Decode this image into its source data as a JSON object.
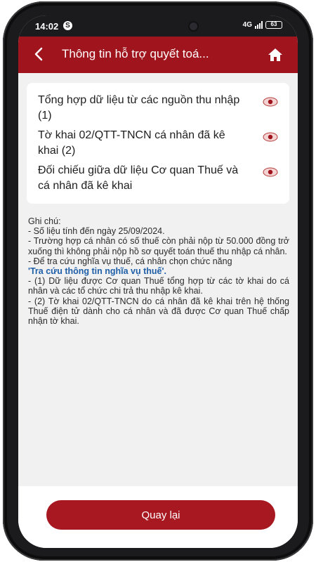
{
  "status_bar": {
    "time": "14:02",
    "app_icon": "S",
    "network": "4G",
    "battery": "63"
  },
  "header": {
    "title": "Thông tin hỗ trợ quyết toá...",
    "back_icon": "chevron-left-icon",
    "home_icon": "home-icon"
  },
  "items": [
    {
      "label": "Tổng hợp dữ liệu từ các nguồn thu nhập (1)",
      "icon": "eye-icon"
    },
    {
      "label": "Tờ khai 02/QTT-TNCN cá nhân đã kê khai (2)",
      "icon": "eye-icon"
    },
    {
      "label": "Đối chiếu giữa dữ liệu Cơ quan Thuế và cá nhân đã kê khai",
      "icon": "eye-icon"
    }
  ],
  "notes": {
    "title": "Ghi chú:",
    "line1": "- Số liệu tính đến ngày 25/09/2024.",
    "line2": "- Trường hợp cá nhân có số thuế còn phải nộp từ 50.000 đồng trở xuống thì không phải nộp hồ sơ quyết toán thuế thu nhập cá nhân.",
    "line3": "- Để tra cứu nghĩa vụ thuế, cá nhân chọn chức năng",
    "link": "'Tra cứu thông tin nghĩa vụ thuế'.",
    "line4": "- (1) Dữ liệu được Cơ quan Thuế tổng hợp từ các tờ khai do cá nhân và các tổ chức chi trả thu nhập kê khai.",
    "line5": "- (2) Tờ khai 02/QTT-TNCN do cá nhân đã kê khai trên hệ thống Thuế điện tử dành cho cá nhân và đã được Cơ quan Thuế chấp nhận tờ khai."
  },
  "footer": {
    "back_button": "Quay lại"
  },
  "colors": {
    "brand": "#a0151d",
    "link": "#1f5fa8",
    "background": "#f1f1f1"
  }
}
